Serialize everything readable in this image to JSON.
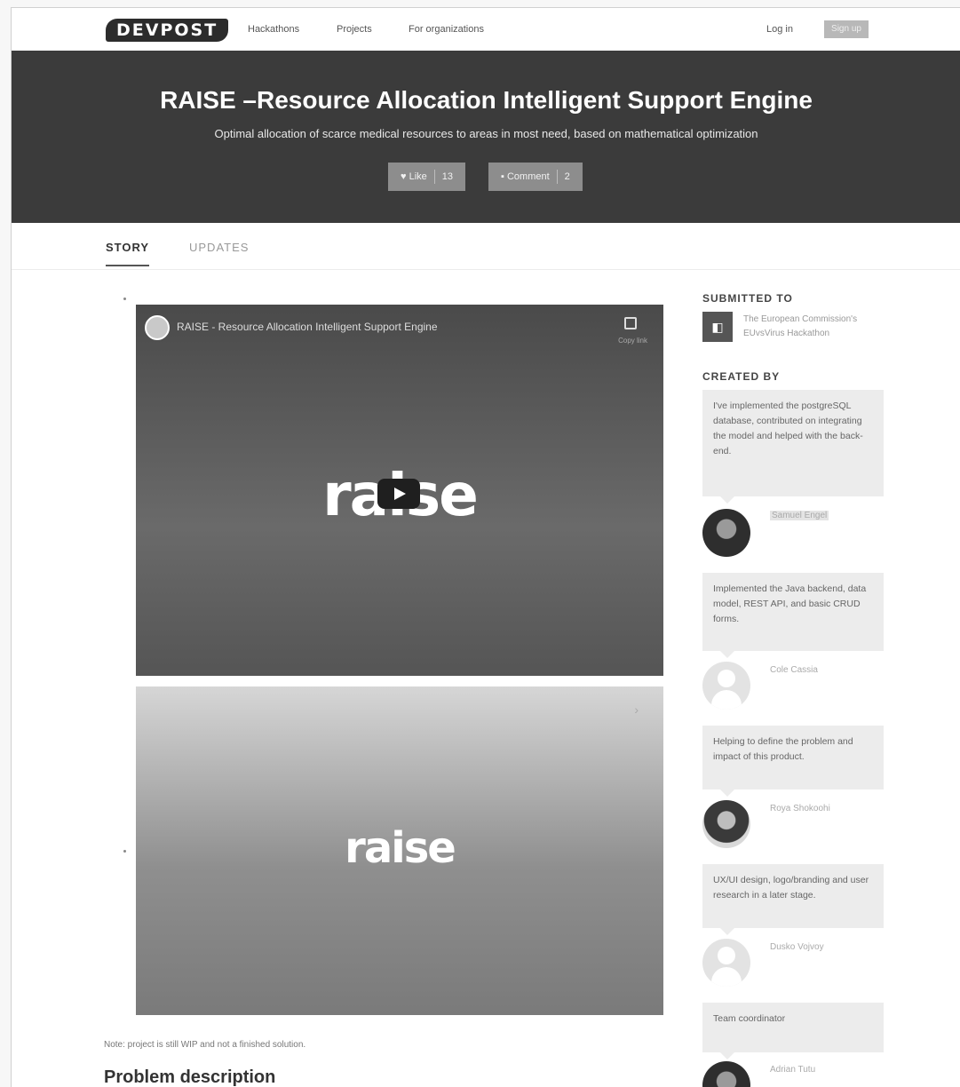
{
  "nav": {
    "logo": "DEVPOST",
    "links": [
      "Hackathons",
      "Projects",
      "For organizations"
    ],
    "login": "Log in",
    "signup": "Sign up"
  },
  "hero": {
    "title": "RAISE  –Resource Allocation Intelligent  Support Engine",
    "tagline": "Optimal allocation of scarce medical resources to areas in most need, based on mathematical optimization",
    "like_label": "Like",
    "like_count": "13",
    "comment_label": "Comment",
    "comment_count": "2"
  },
  "tabs": {
    "story": "STORY",
    "updates": "UPDATES"
  },
  "media": {
    "video_title": "RAISE - Resource Allocation Intelligent Support Engine",
    "copy_label": "Copy link",
    "brand_word_1": "raise",
    "brand_word_2": "raise"
  },
  "main": {
    "note": "Note: project is still WIP and not a finished solution.",
    "section_heading": "Problem description"
  },
  "sidebar": {
    "submitted_heading": "SUBMITTED TO",
    "submitted_to": "The European Commission's EUvsVirus Hackathon",
    "created_heading": "CREATED BY",
    "members": [
      {
        "contribution": "I've implemented the postgreSQL database, contributed on integrating the model and helped with the back-end.",
        "name": "Samuel Engel"
      },
      {
        "contribution": "Implemented the Java backend, data model, REST API, and basic CRUD forms.",
        "name": "Cole Cassia"
      },
      {
        "contribution": "Helping to define the problem and impact of this product.",
        "name": "Roya Shokoohi"
      },
      {
        "contribution": "UX/UI design, logo/branding and user research in a later stage.",
        "name": "Dusko Vojvoy"
      },
      {
        "contribution": "Team coordinator",
        "name": "Adrian Tutu"
      }
    ]
  }
}
